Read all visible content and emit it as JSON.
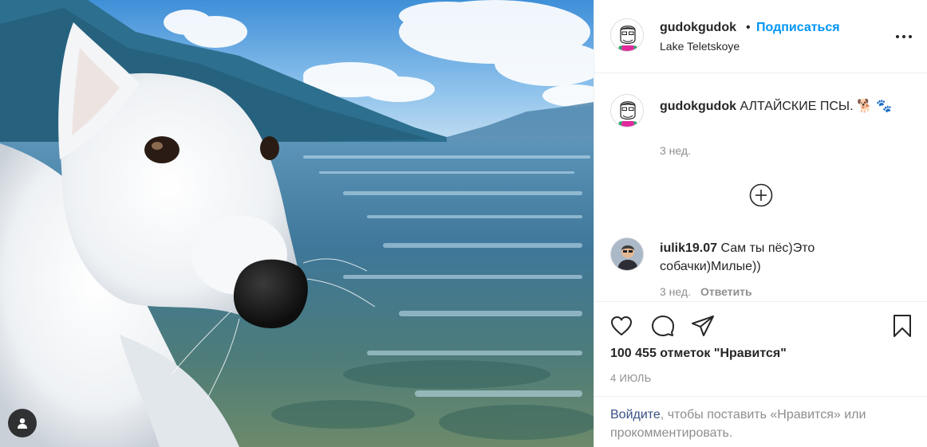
{
  "post": {
    "username": "gudokgudok",
    "dot": "•",
    "follow_label": "Подписаться",
    "location": "Lake Teletskoye"
  },
  "caption": {
    "username": "gudokgudok",
    "text": "АЛТАЙСКИЕ ПСЫ. 🐕 🐾",
    "time": "3 нед."
  },
  "comments": [
    {
      "username": "iulik19.07",
      "text": "Сам ты пёс)Это собачки)Милые))",
      "time": "3 нед.",
      "reply_label": "Ответить"
    }
  ],
  "stats": {
    "likes": "100 455 отметок \"Нравится\"",
    "date": "4 ИЮЛЬ"
  },
  "login_prompt": {
    "link": "Войдите",
    "rest": ", чтобы поставить «Нравится» или прокомментировать."
  },
  "icons": [
    "tag-user-icon",
    "more-options-icon",
    "load-more-icon",
    "heart-icon",
    "comment-icon",
    "share-icon",
    "bookmark-icon"
  ],
  "colors": {
    "link_blue": "#0095f6",
    "login_link": "#385185",
    "muted": "#8e8e8e",
    "text": "#262626"
  }
}
